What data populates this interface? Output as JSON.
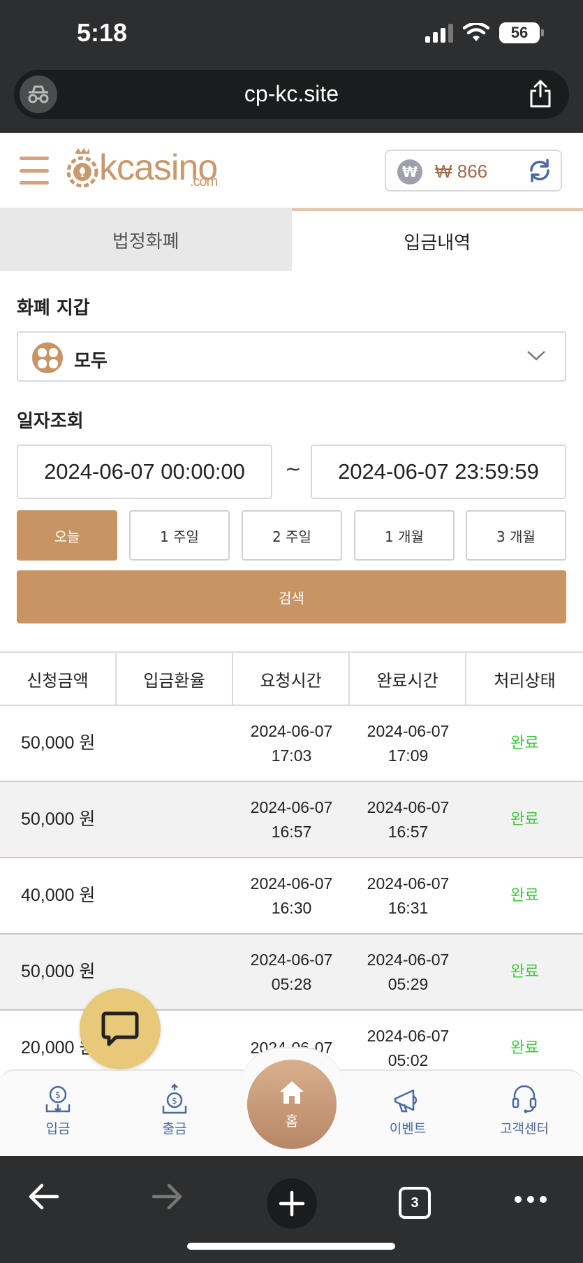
{
  "status_bar": {
    "time": "5:18",
    "battery": "56"
  },
  "browser": {
    "url": "cp-kc.site",
    "tab_count": "3"
  },
  "header": {
    "logo_main": "kcasino",
    "logo_sub": ".com",
    "currency_symbol": "₩",
    "balance": "₩ 866"
  },
  "tabs": [
    {
      "label": "법정화폐",
      "active": false
    },
    {
      "label": "입금내역",
      "active": true
    }
  ],
  "form": {
    "wallet_label": "화폐 지갑",
    "wallet_value": "모두",
    "date_label": "일자조회",
    "date_from": "2024-06-07 00:00:00",
    "date_separator": "~",
    "date_to": "2024-06-07 23:59:59",
    "ranges": [
      "오늘",
      "1 주일",
      "2 주일",
      "1 개월",
      "3 개월"
    ],
    "active_range": "오늘",
    "search_label": "검색"
  },
  "table": {
    "headers": [
      "신청금액",
      "입금환율",
      "요청시간",
      "완료시간",
      "처리상태"
    ],
    "rows": [
      {
        "amount": "50,000 원",
        "rate": "",
        "req_date": "2024-06-07",
        "req_time": "17:03",
        "done_date": "2024-06-07",
        "done_time": "17:09",
        "status": "완료"
      },
      {
        "amount": "50,000 원",
        "rate": "",
        "req_date": "2024-06-07",
        "req_time": "16:57",
        "done_date": "2024-06-07",
        "done_time": "16:57",
        "status": "완료"
      },
      {
        "amount": "40,000 원",
        "rate": "",
        "req_date": "2024-06-07",
        "req_time": "16:30",
        "done_date": "2024-06-07",
        "done_time": "16:31",
        "status": "완료"
      },
      {
        "amount": "50,000 원",
        "rate": "",
        "req_date": "2024-06-07",
        "req_time": "05:28",
        "done_date": "2024-06-07",
        "done_time": "05:29",
        "status": "완료"
      },
      {
        "amount": "20,000 원",
        "rate": "",
        "req_date": "2024-06-07",
        "req_time": "",
        "done_date": "2024-06-07",
        "done_time": "05:02",
        "status": "완료"
      }
    ]
  },
  "bottom_nav": {
    "deposit": "입금",
    "withdraw": "출금",
    "home": "홈",
    "event": "이벤트",
    "support": "고객센터"
  },
  "colors": {
    "accent": "#c99464",
    "status_done": "#3cc83c",
    "nav_text": "#4b6aa0"
  }
}
